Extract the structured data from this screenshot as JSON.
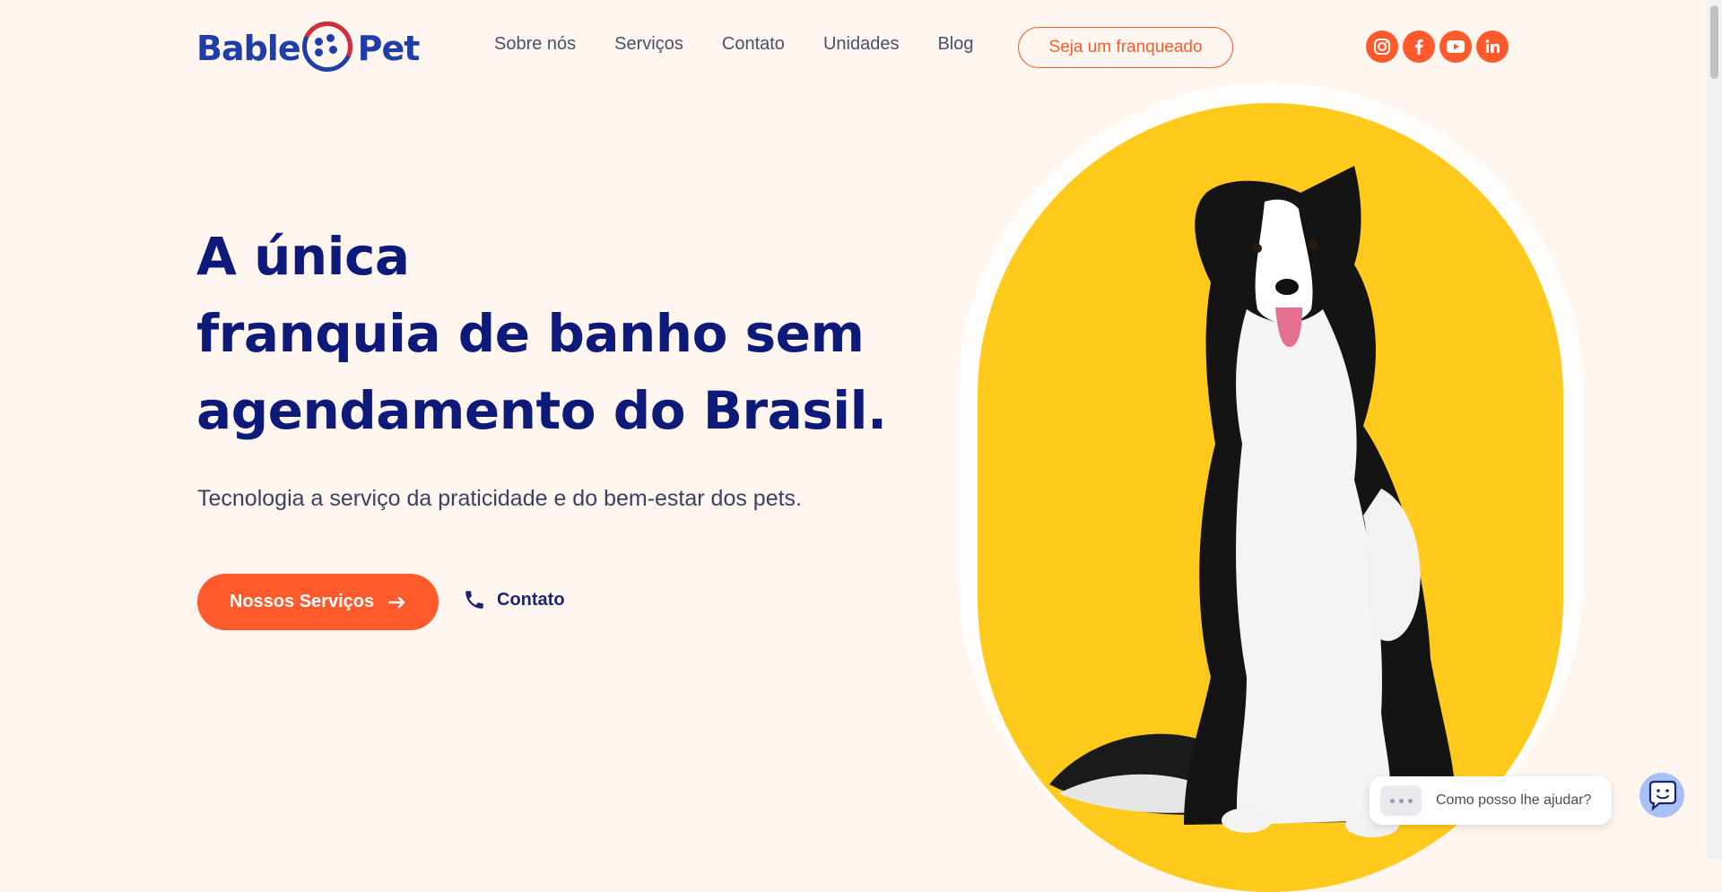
{
  "header": {
    "logo": {
      "text_left": "Bable",
      "text_right": "Pet"
    },
    "nav": [
      "Sobre nós",
      "Serviços",
      "Contato",
      "Unidades",
      "Blog"
    ],
    "franchise_button": "Seja um franqueado",
    "social": [
      "instagram-icon",
      "facebook-icon",
      "youtube-icon",
      "linkedin-icon"
    ]
  },
  "hero": {
    "title_lines": [
      "A única",
      "franquia de banho sem",
      "agendamento do Brasil."
    ],
    "subtitle": "Tecnologia a serviço da praticidade e do bem-estar dos pets.",
    "cta_label": "Nossos Serviços",
    "contact_label": "Contato"
  },
  "chat": {
    "prompt": "Como posso lhe ajudar?"
  },
  "colors": {
    "accent": "#ff5a2b",
    "navy": "#0e1a7a",
    "background": "#fff6ef",
    "yellow": "#ffca1c",
    "logo_blue": "#1f3ea8",
    "logo_red": "#d52d3a"
  }
}
